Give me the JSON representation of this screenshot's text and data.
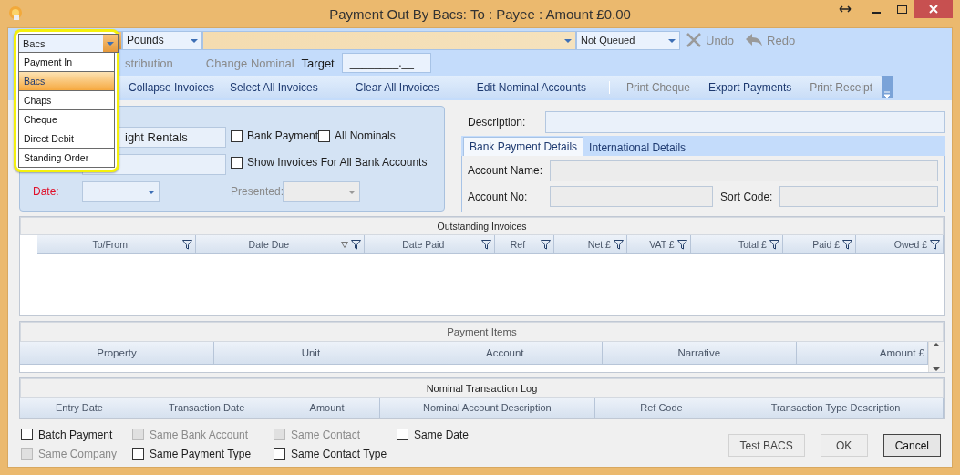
{
  "window": {
    "title": "Payment Out By Bacs: To : Payee : Amount £0.00"
  },
  "toolbar": {
    "payment_type": "Bacs",
    "currency": "Pounds",
    "queue_status": "Not Queued",
    "actions": [
      {
        "kind": "undo",
        "label": "Undo",
        "disabled": true
      },
      {
        "kind": "redo",
        "label": "Redo",
        "disabled": true
      }
    ]
  },
  "options_row": {
    "items": [
      {
        "label": "stribution",
        "disabled": true
      },
      {
        "label": "Change Nominal",
        "disabled": true
      }
    ],
    "target_label": "Target",
    "target_value": "________.__"
  },
  "commands": [
    {
      "label": "Collapse Invoices",
      "disabled": false,
      "separator_before": false
    },
    {
      "label": "Select All Invoices",
      "disabled": false,
      "separator_before": false
    },
    {
      "label": "Clear All Invoices",
      "disabled": false,
      "separator_before": false
    },
    {
      "label": "Edit Nominal Accounts",
      "disabled": false,
      "separator_before": false
    },
    {
      "label": "Print Cheque",
      "disabled": true,
      "separator_before": true
    },
    {
      "label": "Export Payments",
      "disabled": false,
      "separator_before": false
    },
    {
      "label": "Print Receipt",
      "disabled": true,
      "separator_before": false
    }
  ],
  "payment_type_menu": {
    "items": [
      {
        "label": "Payment In",
        "selected": false
      },
      {
        "label": "Bacs",
        "selected": true
      },
      {
        "label": "Chaps",
        "selected": false
      },
      {
        "label": "Cheque",
        "selected": false
      },
      {
        "label": "Direct Debit",
        "selected": false
      },
      {
        "label": "Standing Order",
        "selected": false
      }
    ]
  },
  "details": {
    "payee_value": "ight Rentals",
    "date_label": "Date:",
    "presented_label": "Presented:",
    "checks": [
      {
        "label": "Bank Payment",
        "checked": false
      },
      {
        "label": "All Nominals",
        "checked": false
      },
      {
        "label": "Show Invoices For All Bank Accounts",
        "checked": false
      }
    ]
  },
  "description_label": "Description:",
  "bank_tabs": [
    {
      "label": "Bank Payment Details",
      "selected": true
    },
    {
      "label": "International Details",
      "selected": false
    }
  ],
  "bank_details": {
    "account_name_label": "Account Name:",
    "account_no_label": "Account No:",
    "sort_code_label": "Sort Code:"
  },
  "outstanding_invoices": {
    "title": "Outstanding Invoices",
    "columns": [
      {
        "label": "To/From",
        "sorted": false
      },
      {
        "label": "Date Due",
        "sorted": true
      },
      {
        "label": "Date Paid",
        "sorted": false
      },
      {
        "label": "Ref",
        "sorted": false
      },
      {
        "label": "Net £",
        "sorted": false
      },
      {
        "label": "VAT £",
        "sorted": false
      },
      {
        "label": "Total £",
        "sorted": false
      },
      {
        "label": "Paid £",
        "sorted": false
      },
      {
        "label": "Owed £",
        "sorted": false
      }
    ]
  },
  "payment_items": {
    "title": "Payment Items",
    "columns": [
      "Property",
      "Unit",
      "Account",
      "Narrative",
      "Amount £"
    ]
  },
  "nominal_log": {
    "title": "Nominal Transaction Log",
    "columns": [
      "Entry Date",
      "Transaction Date",
      "Amount",
      "Nominal Account Description",
      "Ref Code",
      "Transaction Type Description"
    ]
  },
  "options": [
    [
      {
        "label": "Batch Payment",
        "checked": false,
        "disabled": false
      },
      {
        "label": "Same Company",
        "checked": false,
        "disabled": true
      }
    ],
    [
      {
        "label": "Same Bank Account",
        "checked": false,
        "disabled": true
      },
      {
        "label": "Same Payment Type",
        "checked": false,
        "disabled": false
      }
    ],
    [
      {
        "label": "Same Contact",
        "checked": false,
        "disabled": true
      },
      {
        "label": "Same Contact Type",
        "checked": false,
        "disabled": false
      }
    ],
    [
      {
        "label": "Same Date",
        "checked": false,
        "disabled": false
      }
    ]
  ],
  "buttons": [
    {
      "label": "Test BACS",
      "focused": false
    },
    {
      "label": "OK",
      "focused": false
    },
    {
      "label": "Cancel",
      "focused": true
    }
  ]
}
